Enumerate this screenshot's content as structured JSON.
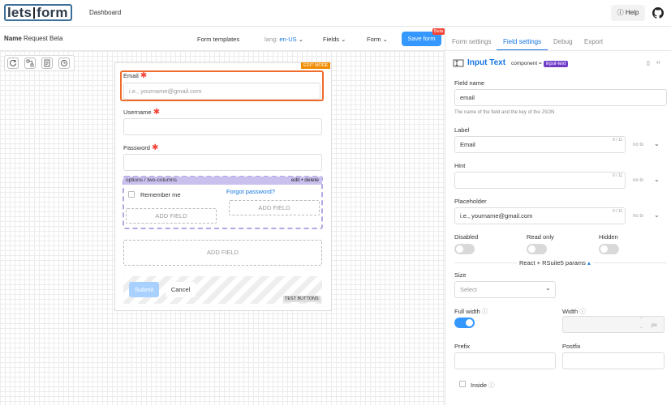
{
  "app": {
    "logo_left": "lets",
    "logo_right": "form",
    "nav_dashboard": "Dashboard",
    "help_label": "Help"
  },
  "toolbar": {
    "name_label": "Name",
    "form_name": "Request Beta",
    "form_templates": "Form templates",
    "lang_label": "lang:",
    "lang_value": "en-US",
    "fields": "Fields",
    "form": "Form",
    "save": "Save form",
    "beta": "Beta"
  },
  "form": {
    "edit_mode": "EDIT MODE",
    "email_label": "Email",
    "email_placeholder": "i.e., yourname@gmail.com",
    "username_label": "Username",
    "password_label": "Password",
    "columns_label": "options / two-columns",
    "edit_delete": "edit • delete",
    "remember_me": "Remember me",
    "forgot": "Forgot password?",
    "add_field": "ADD FIELD",
    "submit": "Submit",
    "cancel": "Cancel",
    "test_buttons": "TEST BUTTONS"
  },
  "panel": {
    "tabs": [
      "Form settings",
      "Field settings",
      "Debug",
      "Export"
    ],
    "component_title": "Input Text",
    "component_label": "component =",
    "component_value": "input-text",
    "field_name_label": "Field name",
    "field_name_value": "email",
    "field_name_hint": "The name of the field and the key of the JSON",
    "label_label": "Label",
    "label_value": "Email",
    "label_count": "0 / 11",
    "hint_label": "Hint",
    "hint_count": "0 / 11",
    "placeholder_label": "Placeholder",
    "placeholder_value": "i.e., yourname@gmail.com",
    "placeholder_count": "0 / 11",
    "notx": "no tx",
    "disabled": "Disabled",
    "readonly": "Read only",
    "hidden": "Hidden",
    "rsuite": "React + RSuite5 params",
    "size_label": "Size",
    "size_placeholder": "Select",
    "fullwidth_label": "Full width",
    "width_label": "Width",
    "width_unit": "px",
    "prefix_label": "Prefix",
    "postfix_label": "Postfix",
    "inside_label": "Inside"
  },
  "colors": {
    "accent": "#1675e0",
    "primary": "#3498ff",
    "selection": "#ef6c2b",
    "badge": "#6f3cc9"
  }
}
